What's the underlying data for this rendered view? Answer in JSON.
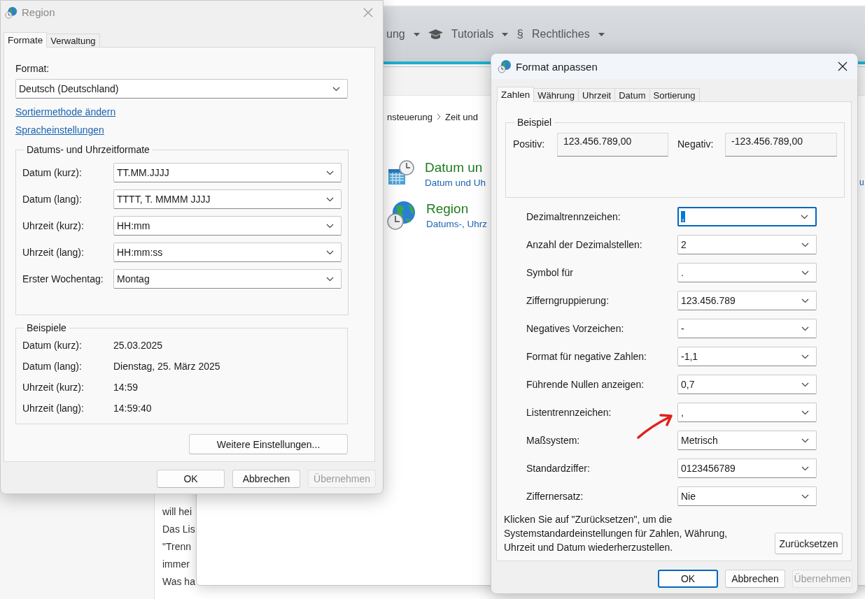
{
  "browser": {
    "nav": [
      {
        "kind": "text",
        "label": "ung"
      },
      {
        "kind": "cap",
        "label": "Tutorials"
      },
      {
        "kind": "symbol",
        "symbol": "§",
        "label": "Rechtliches"
      }
    ],
    "article_lines": [
      "will hei",
      "Das Lis",
      "\"Trenn",
      "immer",
      "Was ha"
    ]
  },
  "control_panel": {
    "breadcrumb": [
      "nsteuerung",
      "Zeit und"
    ],
    "items": [
      {
        "kind": "calendar",
        "title": "Datum un",
        "subtitle": "Datum und Uh"
      },
      {
        "kind": "globe",
        "title": "Region",
        "subtitle": "Datums-, Uhrz"
      }
    ],
    "right_link": "u"
  },
  "region_dialog": {
    "title": "Region",
    "active": false,
    "tabs": [
      {
        "label": "Formate",
        "selected": true
      },
      {
        "label": "Verwaltung",
        "selected": false
      }
    ],
    "format_label": "Format:",
    "format_value": "Deutsch (Deutschland)",
    "links": [
      "Sortiermethode ändern",
      "Spracheinstellungen"
    ],
    "formats_group": {
      "title": "Datums- und Uhrzeitformate",
      "rows": [
        {
          "label": "Datum (kurz):",
          "value": "TT.MM.JJJJ"
        },
        {
          "label": "Datum (lang):",
          "value": "TTTT, T. MMMM JJJJ"
        },
        {
          "label": "Uhrzeit (kurz):",
          "value": "HH:mm"
        },
        {
          "label": "Uhrzeit (lang):",
          "value": "HH:mm:ss"
        },
        {
          "label": "Erster Wochentag:",
          "value": "Montag"
        }
      ]
    },
    "examples_group": {
      "title": "Beispiele",
      "rows": [
        {
          "label": "Datum (kurz):",
          "value": "25.03.2025"
        },
        {
          "label": "Datum (lang):",
          "value": "Dienstag, 25. März 2025"
        },
        {
          "label": "Uhrzeit (kurz):",
          "value": "14:59"
        },
        {
          "label": "Uhrzeit (lang):",
          "value": "14:59:40"
        }
      ]
    },
    "more_button": "Weitere Einstellungen...",
    "buttons": [
      {
        "label": "OK",
        "default": false,
        "disabled": false
      },
      {
        "label": "Abbrechen",
        "default": false,
        "disabled": false
      },
      {
        "label": "Übernehmen",
        "default": false,
        "disabled": true
      }
    ]
  },
  "format_dialog": {
    "title": "Format anpassen",
    "active": true,
    "tabs": [
      {
        "label": "Zahlen",
        "selected": true
      },
      {
        "label": "Währung",
        "selected": false
      },
      {
        "label": "Uhrzeit",
        "selected": false
      },
      {
        "label": "Datum",
        "selected": false
      },
      {
        "label": "Sortierung",
        "selected": false
      }
    ],
    "sample": {
      "title": "Beispiel",
      "positive_label": "Positiv:",
      "positive_value": "123.456.789,00",
      "negative_label": "Negativ:",
      "negative_value": "-123.456.789,00"
    },
    "rows": [
      {
        "label": "Dezimaltrennzeichen:",
        "value": ",",
        "focused": true
      },
      {
        "label": "Anzahl der Dezimalstellen:",
        "value": "2",
        "focused": false
      },
      {
        "label": "Symbol für",
        "value": ".",
        "focused": false
      },
      {
        "label": "Zifferngruppierung:",
        "value": "123.456.789",
        "focused": false
      },
      {
        "label": "Negatives Vorzeichen:",
        "value": "-",
        "focused": false
      },
      {
        "label": "Format für negative Zahlen:",
        "value": "-1,1",
        "focused": false
      },
      {
        "label": "Führende Nullen anzeigen:",
        "value": "0,7",
        "focused": false
      },
      {
        "label": "Listentrennzeichen:",
        "value": ",",
        "focused": false
      },
      {
        "label": "Maßsystem:",
        "value": "Metrisch",
        "focused": false
      },
      {
        "label": "Standardziffer:",
        "value": "0123456789",
        "focused": false
      },
      {
        "label": "Ziffernersatz:",
        "value": "Nie",
        "focused": false
      }
    ],
    "note": "Klicken Sie auf \"Zurücksetzen\", um die Systemstandardeinstellungen für Zahlen, Währung, Uhrzeit und Datum wiederherzustellen.",
    "reset_button": "Zurücksetzen",
    "buttons": [
      {
        "label": "OK",
        "default": true,
        "disabled": false
      },
      {
        "label": "Abbrechen",
        "default": false,
        "disabled": false
      },
      {
        "label": "Übernehmen",
        "default": false,
        "disabled": true
      }
    ]
  }
}
